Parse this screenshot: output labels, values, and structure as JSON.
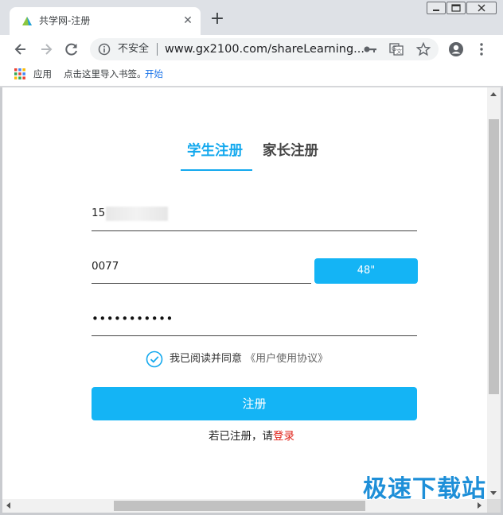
{
  "browser": {
    "tab_title": "共学网-注册",
    "tab_close": "✕",
    "new_tab": "+",
    "security_label": "不安全",
    "url": "www.gx2100.com/shareLearning...",
    "bookmarks": {
      "apps_label": "应用",
      "import_text": "点击这里导入书签。",
      "start_link": "开始"
    }
  },
  "page": {
    "tabs": [
      {
        "label": "学生注册",
        "active": true
      },
      {
        "label": "家长注册",
        "active": false
      }
    ],
    "phone_value": "15",
    "code_value": "0077",
    "countdown_label": "48\"",
    "password_mask": "•••••••••••",
    "agree_text": "我已阅读并同意",
    "agreement_link": "《用户使用协议》",
    "register_label": "注册",
    "login_prompt": "若已注册，请",
    "login_link": "登录"
  },
  "watermark": "极速下载站",
  "colors": {
    "accent": "#14b4f5",
    "tab_active": "#14a9ee",
    "login_link": "#e0241b",
    "watermark": "#1e8fd8"
  },
  "icons": [
    "favicon-icon",
    "close-icon",
    "plus-icon",
    "back-icon",
    "forward-icon",
    "reload-icon",
    "info-icon",
    "key-icon",
    "translate-icon",
    "star-icon",
    "account-icon",
    "menu-icon",
    "apps-icon",
    "check-circle-icon"
  ]
}
